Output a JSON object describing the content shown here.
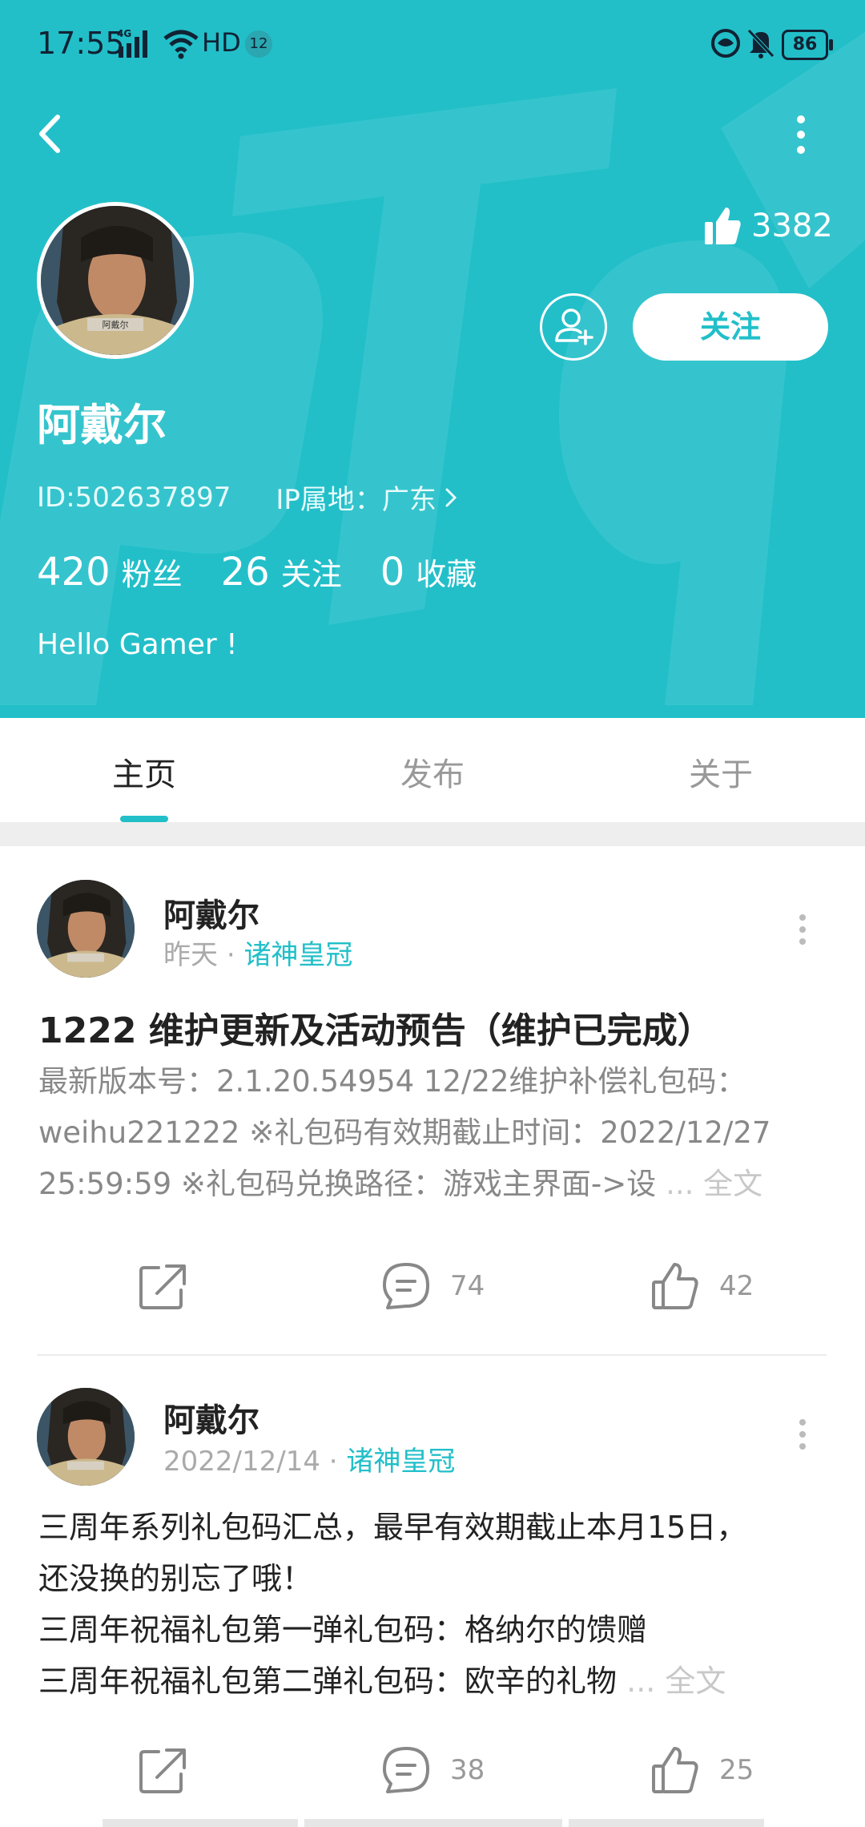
{
  "status_bar": {
    "time": "17:55",
    "network": "4G",
    "wifi_label": "HD",
    "notif_count": "12",
    "battery": "86"
  },
  "header": {
    "likes": "3382",
    "follow_label": "关注",
    "name": "阿戴尔",
    "id_text": "ID:502637897",
    "ip_text": "IP属地：广东",
    "stats": [
      {
        "num": "420",
        "label": "粉丝"
      },
      {
        "num": "26",
        "label": "关注"
      },
      {
        "num": "0",
        "label": "收藏"
      }
    ],
    "bio": "Hello Gamer !",
    "avatar_caption": "阿戴尔",
    "bg_color": "#22bfc9"
  },
  "tabs": [
    {
      "label": "主页",
      "active": true
    },
    {
      "label": "发布",
      "active": false
    },
    {
      "label": "关于",
      "active": false
    }
  ],
  "posts": [
    {
      "author": "阿戴尔",
      "time": "昨天",
      "separator": "·",
      "topic": "诸神皇冠",
      "title": "1222 维护更新及活动预告（维护已完成）",
      "body": [
        "最新版本号：2.1.20.54954 12/22维护补偿礼包码：",
        "weihu221222 ※礼包码有效期截止时间：2022/12/27",
        "25:59:59 ※礼包码兑换路径：游戏主界面->设"
      ],
      "more": "... 全文",
      "comments": "74",
      "likes": "42"
    },
    {
      "author": "阿戴尔",
      "time": "2022/12/14",
      "separator": "·",
      "topic": "诸神皇冠",
      "body": [
        "三周年系列礼包码汇总，最早有效期截止本月15日，",
        "还没换的别忘了哦！",
        "三周年祝福礼包第一弹礼包码：格纳尔的馈赠",
        "三周年祝福礼包第二弹礼包码：欧辛的礼物"
      ],
      "more": "... 全文",
      "comments": "38",
      "likes": "25"
    }
  ],
  "icons": {
    "back": "back-arrow-icon",
    "more": "more-vertical-icon",
    "thumb": "thumbs-up-icon",
    "add_friend": "add-friend-icon",
    "share": "share-icon",
    "comment": "comment-icon",
    "chevron": "chevron-right-icon"
  }
}
